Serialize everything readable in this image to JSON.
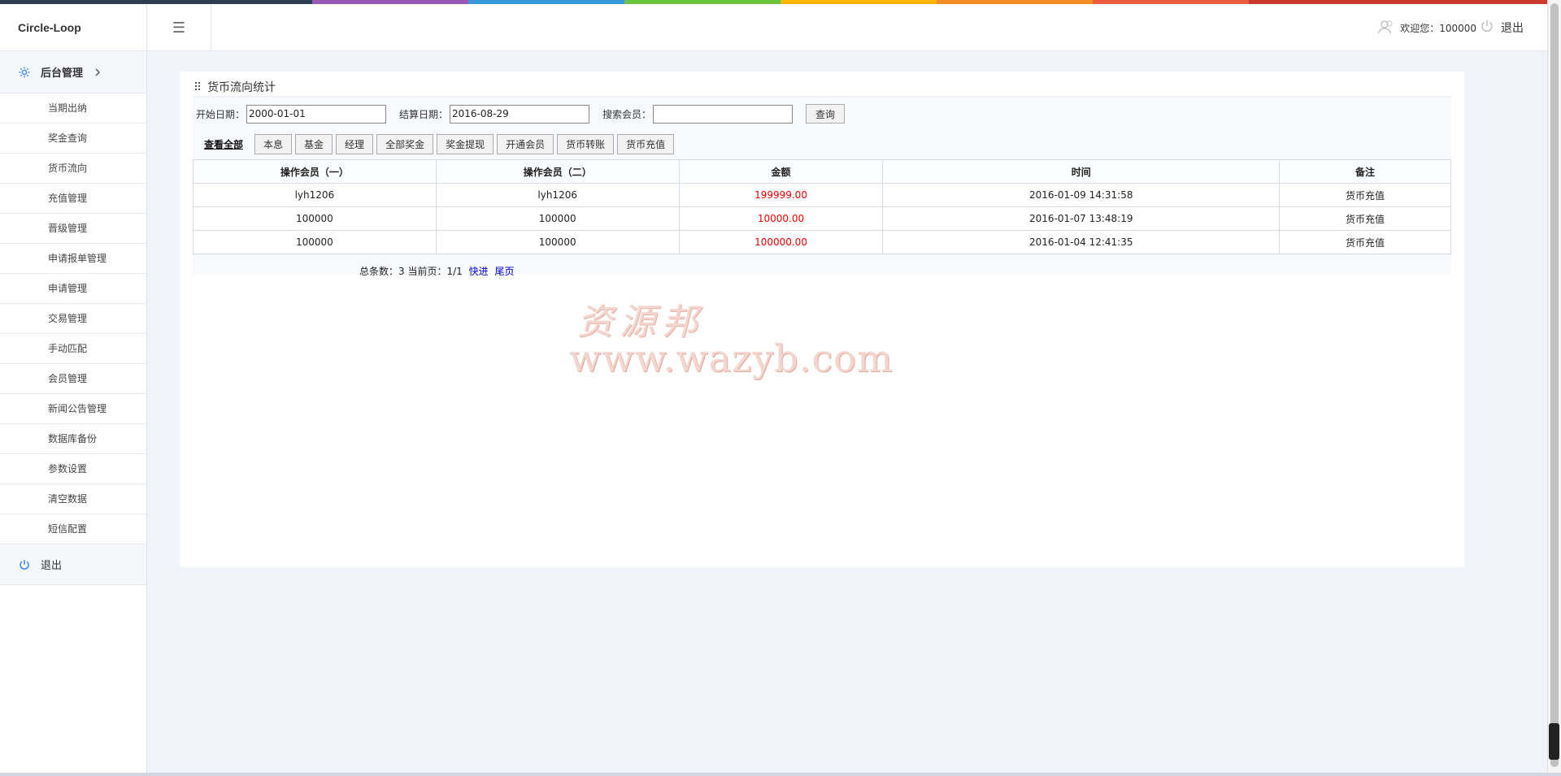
{
  "brand": "Circle-Loop",
  "stripe_colors": [
    "#2d3e50",
    "#2d3e50",
    "#9b59b6",
    "#3498db",
    "#6ac13a",
    "#ffb400",
    "#f08a24",
    "#ea5a3d",
    "#cc3a2c",
    "#cc3a2c"
  ],
  "sidebar": {
    "group_label": "后台管理",
    "items": [
      {
        "label": "当期出纳"
      },
      {
        "label": "奖金查询"
      },
      {
        "label": "货币流向"
      },
      {
        "label": "充值管理"
      },
      {
        "label": "晋级管理"
      },
      {
        "label": "申请报单管理"
      },
      {
        "label": "申请管理"
      },
      {
        "label": "交易管理"
      },
      {
        "label": "手动匹配"
      },
      {
        "label": "会员管理"
      },
      {
        "label": "新闻公告管理"
      },
      {
        "label": "数据库备份"
      },
      {
        "label": "参数设置"
      },
      {
        "label": "清空数据"
      },
      {
        "label": "短信配置"
      }
    ],
    "logout_label": "退出"
  },
  "header": {
    "toggle_icon": "☰",
    "welcome": "欢迎您：100000",
    "logout": "退出"
  },
  "panel": {
    "title": "货币流向统计",
    "start_label": "开始日期：",
    "start_value": "2000-01-01",
    "end_label": "结算日期：",
    "end_value": "2016-08-29",
    "member_label": "搜索会员：",
    "member_value": "",
    "query_button": "查询",
    "filter_all": "查看全部",
    "filters": [
      "本息",
      "基金",
      "经理",
      "全部奖金",
      "奖金提现",
      "开通会员",
      "货币转账",
      "货币充值"
    ]
  },
  "table": {
    "headers": [
      "操作会员（一）",
      "操作会员（二）",
      "金额",
      "时间",
      "备注"
    ],
    "rows": [
      [
        "lyh1206",
        "lyh1206",
        "199999.00",
        "2016-01-09 14:31:58",
        "货币充值"
      ],
      [
        "100000",
        "100000",
        "10000.00",
        "2016-01-07 13:48:19",
        "货币充值"
      ],
      [
        "100000",
        "100000",
        "100000.00",
        "2016-01-04 12:41:35",
        "货币充值"
      ]
    ]
  },
  "pager": {
    "summary": "总条数：3 当前页：1/1",
    "fast": "快进",
    "last": "尾页"
  },
  "watermark": {
    "cn": "资源邦",
    "url": "www.wazyb.com"
  }
}
